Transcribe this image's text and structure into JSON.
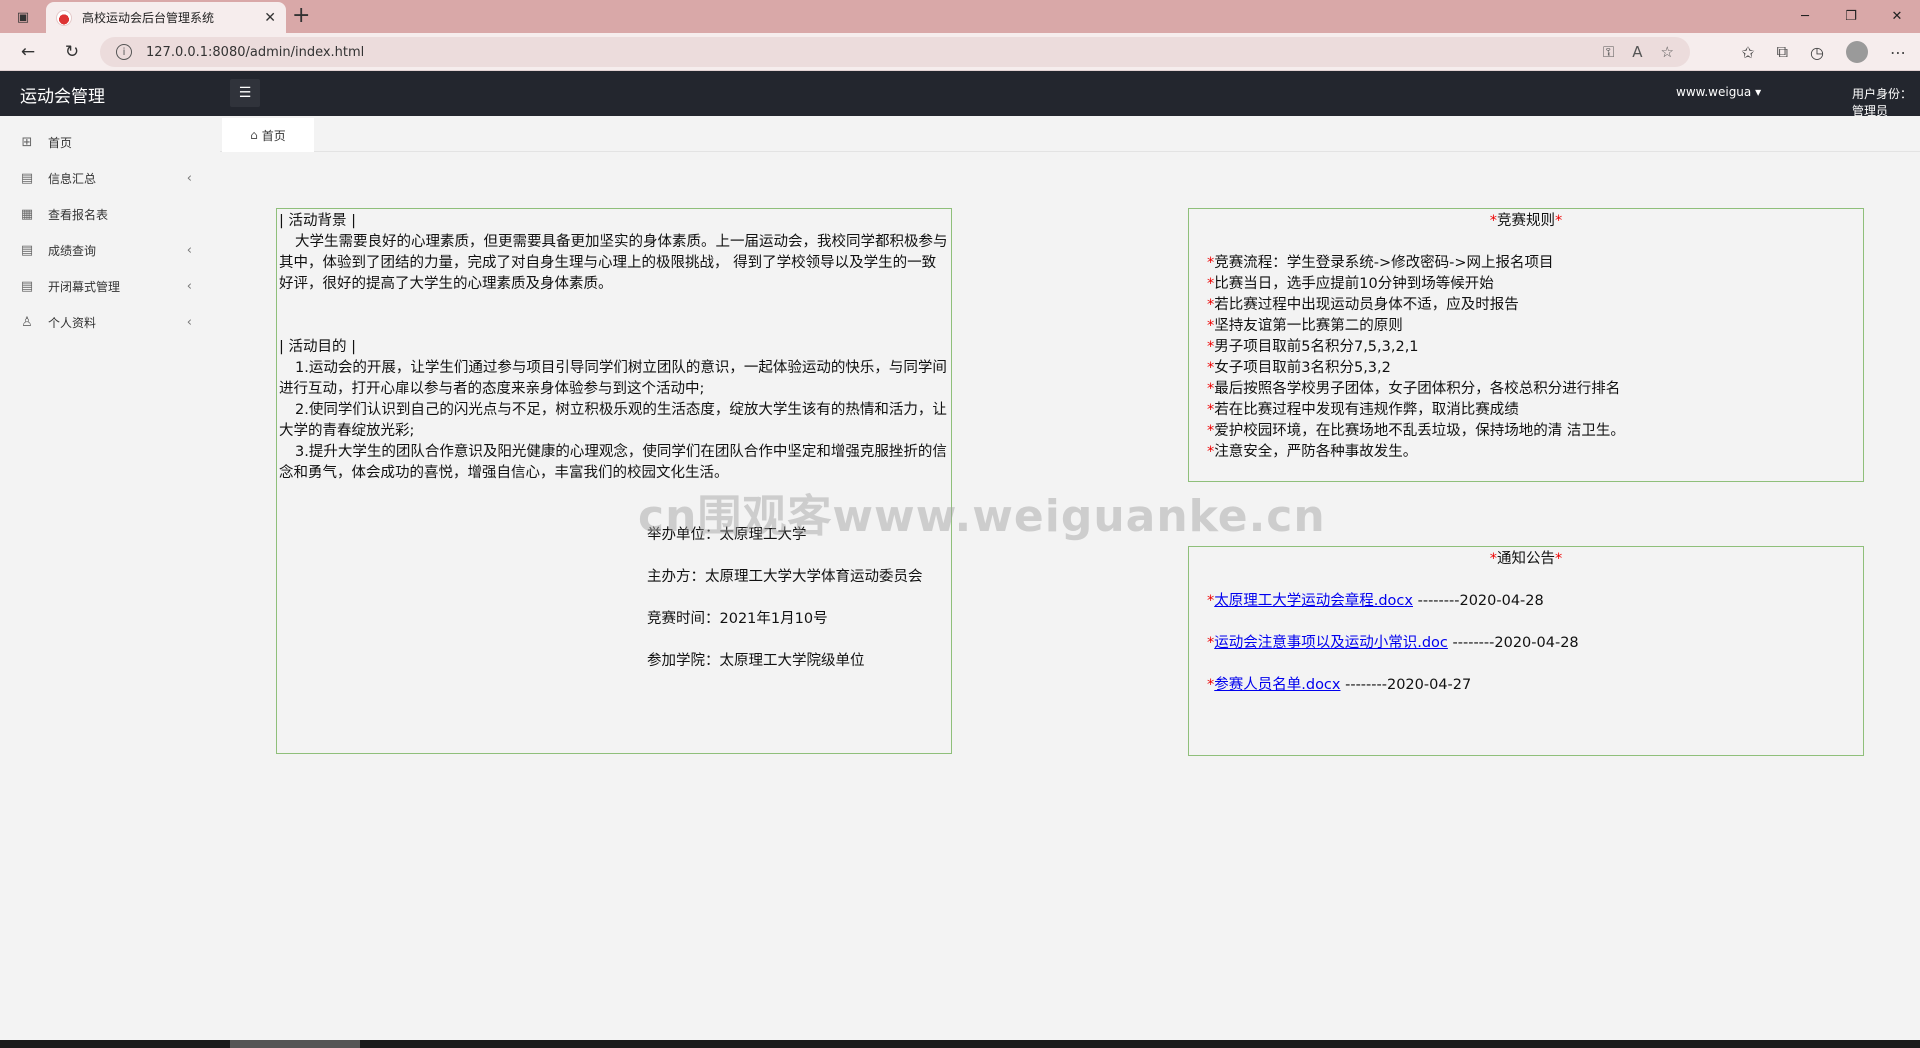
{
  "browser": {
    "tab_title": "高校运动会后台管理系统",
    "url": "127.0.0.1:8080/admin/index.html",
    "new_tab": "+",
    "close_tab": "✕"
  },
  "header": {
    "brand": "运动会管理",
    "user": "www.weigua ▾",
    "role": "用户身份：管理员"
  },
  "sidebar": {
    "items": [
      {
        "label": "首页",
        "icon": "grid-icon",
        "expandable": false
      },
      {
        "label": "信息汇总",
        "icon": "edit-doc-icon",
        "expandable": true
      },
      {
        "label": "查看报名表",
        "icon": "list-doc-icon",
        "expandable": false
      },
      {
        "label": "成绩查询",
        "icon": "edit-doc-icon",
        "expandable": true
      },
      {
        "label": "开闭幕式管理",
        "icon": "edit-doc-icon",
        "expandable": true
      },
      {
        "label": "个人资料",
        "icon": "user-icon",
        "expandable": true
      }
    ]
  },
  "tabs": {
    "home": "首页"
  },
  "intro": {
    "bg_title": "| 活动背景 |",
    "bg_text": "大学生需要良好的心理素质，但更需要具备更加坚实的身体素质。上一届运动会，我校同学都积极参与其中，体验到了团结的力量，完成了对自身生理与心理上的极限挑战， 得到了学校领导以及学生的一致好评，很好的提高了大学生的心理素质及身体素质。",
    "goal_title": "| 活动目的 |",
    "goal_1": "1.运动会的开展，让学生们通过参与项目引导同学们树立团队的意识，一起体验运动的快乐，与同学间进行互动，打开心扉以参与者的态度来亲身体验参与到这个活动中;",
    "goal_2": "2.使同学们认识到自己的闪光点与不足，树立积极乐观的生活态度，绽放大学生该有的热情和活力，让大学的青春绽放光彩;",
    "goal_3": "3.提升大学生的团队合作意识及阳光健康的心理观念，使同学们在团队合作中坚定和增强克服挫折的信念和勇气，体会成功的喜悦，增强自信心，丰富我们的校园文化生活。",
    "host": "举办单位：太原理工大学",
    "organizer": "主办方：太原理工大学大学体育运动委员会",
    "date": "竞赛时间：2021年1月10号",
    "participants": "参加学院：太原理工大学院级单位"
  },
  "rules": {
    "title": "竞赛规则",
    "star": "*",
    "items": [
      "竞赛流程：学生登录系统->修改密码->网上报名项目",
      "比赛当日，选手应提前10分钟到场等候开始",
      "若比赛过程中出现运动员身体不适，应及时报告",
      "坚持友谊第一比赛第二的原则",
      "男子项目取前5名积分7,5,3,2,1",
      "女子项目取前3名积分5,3,2",
      "最后按照各学校男子团体，女子团体积分，各校总积分进行排名",
      "若在比赛过程中发现有违规作弊，取消比赛成绩",
      "爱护校园环境，在比赛场地不乱丢垃圾，保持场地的清 洁卫生。",
      "注意安全，严防各种事故发生。"
    ]
  },
  "notices": {
    "title": "通知公告",
    "items": [
      {
        "link": "太原理工大学运动会章程.docx",
        "date": " --------2020-04-28"
      },
      {
        "link": "运动会注意事项以及运动小常识.doc",
        "date": " --------2020-04-28"
      },
      {
        "link": "参赛人员名单.docx",
        "date": " --------2020-04-27"
      }
    ]
  },
  "watermark": "cn围观客www.weiguanke.cn",
  "colors": {
    "header_bg": "#23262e",
    "panel_border": "#8fbf7a",
    "star_red": "#ee0000",
    "link_blue": "#0000ee",
    "tabstrip_bg": "#d9a8a8"
  }
}
